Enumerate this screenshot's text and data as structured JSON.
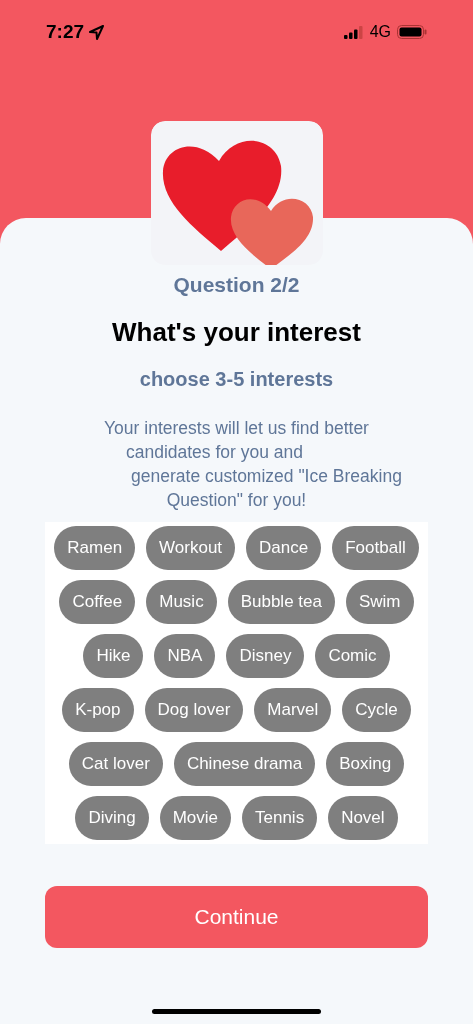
{
  "status_bar": {
    "time": "7:27",
    "network": "4G"
  },
  "progress": "Question 2/2",
  "title": "What's your interest",
  "subtitle": "choose 3-5 interests",
  "description_lines": [
    "Your interests will let us find better",
    "candidates for you and",
    "generate customized \"Ice Breaking",
    "Question\" for you!"
  ],
  "interest_rows": [
    [
      {
        "label": "Ramen",
        "selected": false
      },
      {
        "label": "Workout",
        "selected": false
      },
      {
        "label": "Dance",
        "selected": false
      },
      {
        "label": "Football",
        "selected": false
      }
    ],
    [
      {
        "label": "Coffee",
        "selected": false
      },
      {
        "label": "Music",
        "selected": false
      },
      {
        "label": "Bubble tea",
        "selected": false
      },
      {
        "label": "Swim",
        "selected": false
      }
    ],
    [
      {
        "label": "Hike",
        "selected": false
      },
      {
        "label": "NBA",
        "selected": false
      },
      {
        "label": "Disney",
        "selected": false
      },
      {
        "label": "Comic",
        "selected": false
      }
    ],
    [
      {
        "label": "K-pop",
        "selected": false
      },
      {
        "label": "Dog lover",
        "selected": false
      },
      {
        "label": "Marvel",
        "selected": false
      },
      {
        "label": "Cycle",
        "selected": false
      }
    ],
    [
      {
        "label": "Cat lover",
        "selected": false
      },
      {
        "label": "Chinese drama",
        "selected": false
      },
      {
        "label": "Boxing",
        "selected": false
      }
    ],
    [
      {
        "label": "Diving",
        "selected": false
      },
      {
        "label": "Movie",
        "selected": false
      },
      {
        "label": "Tennis",
        "selected": false
      },
      {
        "label": "Novel",
        "selected": false
      }
    ]
  ],
  "continue_button": "Continue"
}
